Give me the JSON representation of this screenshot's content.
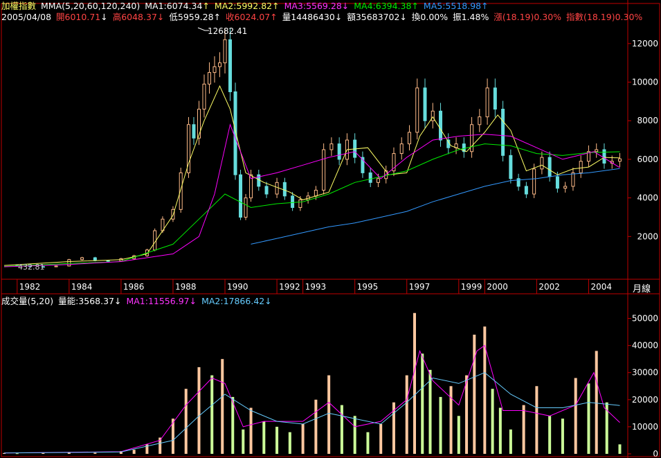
{
  "colors": {
    "background": "#000000",
    "frame": "#c00000",
    "price_up": "#ffbb88",
    "price_down": "#66dddd",
    "ma1": "#ffff66",
    "ma2": "#00ee00",
    "ma3": "#ff00ff",
    "ma4": "#00ee00",
    "ma5": "#3399ff",
    "vol_up": "#ffc8a0",
    "vol_down": "#ccff99",
    "vol_ma1": "#ff00ff",
    "vol_ma2": "#66ccff",
    "text": "#ffffff",
    "grid": "#880000"
  },
  "header": {
    "name": "加權指數",
    "ma_set": "MMA(5,20,60,120,240)",
    "ma1": "MA1:6074.34",
    "ma1_arrow": "↑",
    "ma2": "MA2:5992.82",
    "ma2_arrow": "↑",
    "ma3": "MA3:5569.28",
    "ma3_arrow": "↓",
    "ma4": "MA4:6394.38",
    "ma4_arrow": "↑",
    "ma5": "MA5:5518.98",
    "ma5_arrow": "↑",
    "date": "2005/04/08",
    "open": "開6010.71",
    "open_arrow": "↓",
    "high": "高6048.37",
    "high_arrow": "↓",
    "low": "低5959.28",
    "low_arrow": "↑",
    "close": "收6024.07",
    "close_arrow": "↑",
    "volume": "量14486430",
    "volume_arrow": "↓",
    "amount": "額35683702",
    "amount_arrow": "↓",
    "turnover": "換0.00%",
    "amplitude": "振1.48%",
    "change": "漲(18.19)0.30%",
    "index_change": "指數(18.19)0.30%"
  },
  "volume_header": {
    "name": "成交量(5,20)",
    "energy": "量能:3568.37",
    "energy_arrow": "↓",
    "ma1": "MA1:11556.97",
    "ma1_arrow": "↓",
    "ma2": "MA2:17866.42",
    "ma2_arrow": "↓"
  },
  "annotations": {
    "peak": "12682.41",
    "trough": "432.81"
  },
  "period_label": "月線",
  "chart_data": [
    {
      "type": "candlestick",
      "title": "加權指數",
      "x_ticks": [
        "1982",
        "1984",
        "1986",
        "1988",
        "1990",
        "1992",
        "1993",
        "1995",
        "1997",
        "1999",
        "2000",
        "2002",
        "2004"
      ],
      "x_tick_values": [
        1982,
        1984,
        1986,
        1988,
        1990,
        1992,
        1993,
        1995,
        1997,
        1999,
        2000,
        2002,
        2004
      ],
      "ylim": [
        0,
        13000
      ],
      "y_ticks": [
        2000,
        4000,
        6000,
        8000,
        10000,
        12000
      ],
      "grid": false,
      "series": [
        {
          "name": "指數",
          "x": [
            1981.5,
            1982,
            1982.5,
            1983,
            1983.5,
            1984,
            1984.5,
            1985,
            1985.5,
            1986,
            1986.5,
            1987,
            1987.3,
            1987.6,
            1988,
            1988.3,
            1988.6,
            1988.8,
            1989,
            1989.2,
            1989.4,
            1989.6,
            1989.8,
            1990,
            1990.2,
            1990.4,
            1990.6,
            1990.8,
            1991,
            1991.3,
            1991.6,
            1992,
            1992.3,
            1992.6,
            1992.9,
            1993.2,
            1993.5,
            1993.8,
            1994.1,
            1994.4,
            1994.7,
            1995,
            1995.3,
            1995.6,
            1995.9,
            1996.2,
            1996.5,
            1996.8,
            1997.1,
            1997.4,
            1997.7,
            1998,
            1998.3,
            1998.6,
            1998.9,
            1999.2,
            1999.5,
            1999.8,
            2000.1,
            2000.4,
            2000.7,
            2001,
            2001.3,
            2001.6,
            2001.9,
            2002.2,
            2002.5,
            2002.8,
            2003.1,
            2003.4,
            2003.7,
            2004,
            2004.3,
            2004.6,
            2004.9,
            2005.2
          ],
          "values": [
            500,
            470,
            440,
            430,
            470,
            800,
            900,
            750,
            720,
            850,
            1000,
            1300,
            2300,
            2900,
            3400,
            5300,
            7800,
            7100,
            8600,
            9900,
            10500,
            10800,
            11000,
            12200,
            9500,
            5200,
            3000,
            4000,
            5200,
            4600,
            4200,
            4800,
            4100,
            3500,
            3900,
            4100,
            4400,
            6500,
            6800,
            6000,
            7000,
            6100,
            5300,
            4800,
            5000,
            5400,
            6300,
            6800,
            7400,
            9700,
            8000,
            8500,
            7000,
            6600,
            6800,
            6400,
            7800,
            8200,
            9700,
            8600,
            6200,
            5000,
            4600,
            4200,
            5500,
            6100,
            5100,
            4500,
            4600,
            5300,
            5900,
            6400,
            6500,
            5800,
            5900,
            6024
          ]
        },
        {
          "name": "MA1",
          "x": [
            1981.5,
            1984,
            1986,
            1987,
            1988,
            1988.6,
            1989.2,
            1989.8,
            1990.2,
            1990.8,
            1991.5,
            1992.5,
            1993,
            1994,
            1994.7,
            1995.5,
            1996.3,
            1997,
            1997.5,
            1998,
            1998.7,
            1999.3,
            2000,
            2000.5,
            2001,
            2001.6,
            2002.2,
            2002.8,
            2003.4,
            2004,
            2004.6,
            2005.2
          ],
          "values": [
            500,
            700,
            800,
            1100,
            3100,
            5800,
            8000,
            9800,
            8600,
            5300,
            4800,
            4300,
            3900,
            4300,
            6500,
            6600,
            5200,
            5300,
            7200,
            8200,
            6700,
            6400,
            7400,
            8300,
            7500,
            5400,
            5700,
            5200,
            5500,
            5600,
            6100,
            6074
          ]
        },
        {
          "name": "MA2",
          "x": [
            1981.5,
            1984,
            1986,
            1988,
            1989,
            1990,
            1991,
            1992,
            1993,
            1994,
            1995,
            1996,
            1997,
            1998,
            1999,
            2000,
            2001,
            2002,
            2003,
            2004,
            2005.2
          ],
          "values": [
            450,
            600,
            700,
            1600,
            2900,
            4200,
            3500,
            3700,
            3800,
            4200,
            4800,
            5100,
            5400,
            6000,
            6500,
            6800,
            6700,
            6300,
            6200,
            6350,
            6394
          ]
        },
        {
          "name": "MA3",
          "x": [
            1981.5,
            1984,
            1986,
            1988,
            1989,
            1989.6,
            1990.2,
            1991,
            1992,
            1993,
            1994,
            1995,
            1996,
            1997,
            1998,
            1999,
            2000,
            2001,
            2002,
            2003,
            2003.6,
            2004.2,
            2005.2
          ],
          "values": [
            430,
            550,
            700,
            1100,
            2000,
            4200,
            7800,
            5000,
            5300,
            5700,
            6100,
            6400,
            5000,
            6100,
            7000,
            7200,
            7300,
            7200,
            6600,
            6000,
            6200,
            6400,
            5569
          ]
        },
        {
          "name": "MA5",
          "x": [
            1991,
            1992,
            1993,
            1994,
            1995,
            1996,
            1997,
            1998,
            1999,
            2000,
            2001,
            2002,
            2003,
            2004,
            2005.2
          ],
          "values": [
            1600,
            1900,
            2200,
            2500,
            2700,
            3000,
            3300,
            3800,
            4200,
            4600,
            4900,
            5000,
            5200,
            5300,
            5519
          ]
        }
      ]
    },
    {
      "type": "bar",
      "title": "成交量(5,20)",
      "ylim": [
        0,
        55000
      ],
      "y_ticks": [
        0,
        10000,
        20000,
        30000,
        40000,
        50000
      ],
      "series": [
        {
          "name": "成交量",
          "x": [
            1981.5,
            1982,
            1983,
            1984,
            1985,
            1986,
            1986.5,
            1987,
            1987.5,
            1988,
            1988.5,
            1989,
            1989.5,
            1989.9,
            1990.3,
            1990.7,
            1991,
            1991.5,
            1992,
            1992.5,
            1993,
            1993.5,
            1994,
            1994.5,
            1995,
            1995.5,
            1996,
            1996.5,
            1997,
            1997.3,
            1997.6,
            1997.9,
            1998.3,
            1998.7,
            1999,
            1999.3,
            1999.6,
            2000,
            2000.3,
            2000.6,
            2001,
            2001.5,
            2002,
            2002.5,
            2003,
            2003.5,
            2004,
            2004.3,
            2004.7,
            2005.2
          ],
          "values": [
            300,
            200,
            300,
            400,
            400,
            1000,
            1500,
            3500,
            6000,
            13000,
            24000,
            32000,
            29000,
            35000,
            21000,
            9000,
            17000,
            12000,
            10000,
            8000,
            11000,
            20000,
            29000,
            18000,
            14000,
            8000,
            11000,
            19000,
            29000,
            52000,
            37000,
            31000,
            21000,
            25000,
            14000,
            29000,
            44000,
            47000,
            24000,
            17000,
            9000,
            18000,
            25000,
            14000,
            13000,
            28000,
            26000,
            38000,
            19000,
            3500
          ]
        },
        {
          "name": "MA1",
          "x": [
            1981.5,
            1986,
            1987.5,
            1988.5,
            1989.5,
            1990,
            1990.7,
            1991.5,
            1993,
            1994,
            1995,
            1996,
            1997,
            1997.5,
            1998,
            1999,
            1999.7,
            2000,
            2000.7,
            2001.5,
            2002.5,
            2003.5,
            2004.2,
            2004.6,
            2005.2
          ],
          "values": [
            300,
            800,
            5000,
            18000,
            28000,
            26000,
            10000,
            12000,
            12000,
            19000,
            10000,
            12000,
            20000,
            38000,
            27000,
            18000,
            38000,
            40000,
            16000,
            16000,
            14000,
            18000,
            30000,
            17000,
            11557
          ]
        },
        {
          "name": "MA2",
          "x": [
            1981.5,
            1986,
            1988,
            1989,
            1990,
            1991,
            1992,
            1993,
            1994,
            1995,
            1996,
            1997,
            1998,
            1999,
            2000,
            2001,
            2002,
            2003,
            2004,
            2005.2
          ],
          "values": [
            300,
            700,
            5000,
            14000,
            22000,
            16000,
            12000,
            11000,
            15000,
            13000,
            11000,
            19000,
            28000,
            26000,
            30000,
            22000,
            17000,
            17000,
            19000,
            17866
          ]
        }
      ]
    }
  ]
}
